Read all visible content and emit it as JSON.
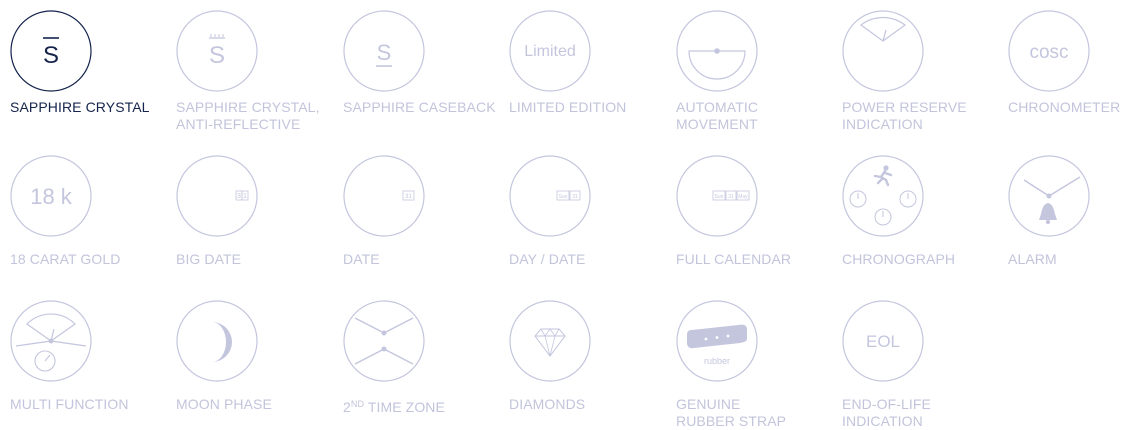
{
  "colors": {
    "active": "#15244b",
    "inactive": "#c2c4db",
    "icon_stroke": "#c4c6de"
  },
  "features": [
    {
      "id": "sapphire_crystal",
      "label1": "SAPPHIRE CRYSTAL",
      "label2": "",
      "icon": "letter-s-overline-icon",
      "glyph": "S",
      "active": true
    },
    {
      "id": "sapphire_crystal_ar",
      "label1": "SAPPHIRE CRYSTAL,",
      "label2": "ANTI-REFLECTIVE",
      "icon": "letter-s-antireflective-icon",
      "glyph": "S",
      "active": false
    },
    {
      "id": "sapphire_caseback",
      "label1": "SAPPHIRE CASEBACK",
      "label2": "",
      "icon": "letter-s-underline-icon",
      "glyph": "S",
      "active": false
    },
    {
      "id": "limited_edition",
      "label1": "LIMITED EDITION",
      "label2": "",
      "icon": "limited-text-icon",
      "glyph": "Limited",
      "active": false
    },
    {
      "id": "automatic_movement",
      "label1": "AUTOMATIC",
      "label2": "MOVEMENT",
      "icon": "rotor-icon",
      "active": false
    },
    {
      "id": "power_reserve",
      "label1": "POWER RESERVE",
      "label2": "INDICATION",
      "icon": "power-gauge-icon",
      "active": false
    },
    {
      "id": "chronometer",
      "label1": "CHRONOMETER",
      "label2": "",
      "icon": "cosc-text-icon",
      "glyph": "cosc",
      "active": false
    },
    {
      "id": "gold_18k",
      "label1": "18 CARAT GOLD",
      "label2": "",
      "icon": "karat-text-icon",
      "glyph": "18 k",
      "active": false
    },
    {
      "id": "big_date",
      "label1": "BIG DATE",
      "label2": "",
      "icon": "big-date-window-icon",
      "date": "3",
      "date2": "1",
      "active": false
    },
    {
      "id": "date",
      "label1": "DATE",
      "label2": "",
      "icon": "date-window-icon",
      "date": "31",
      "active": false
    },
    {
      "id": "day_date",
      "label1": "DAY / DATE",
      "label2": "",
      "icon": "day-date-window-icon",
      "day": "Sun",
      "date": "31",
      "active": false
    },
    {
      "id": "full_calendar",
      "label1": "FULL CALENDAR",
      "label2": "",
      "icon": "full-calendar-window-icon",
      "day": "Sun",
      "date": "31",
      "month": "May",
      "active": false
    },
    {
      "id": "chronograph",
      "label1": "CHRONOGRAPH",
      "label2": "",
      "icon": "chronograph-runner-icon",
      "active": false
    },
    {
      "id": "alarm",
      "label1": "ALARM",
      "label2": "",
      "icon": "alarm-bell-icon",
      "active": false
    },
    {
      "id": "multi_function",
      "label1": "MULTI FUNCTION",
      "label2": "",
      "icon": "multi-function-dial-icon",
      "active": false
    },
    {
      "id": "moon_phase",
      "label1": "MOON PHASE",
      "label2": "",
      "icon": "crescent-moon-icon",
      "active": false
    },
    {
      "id": "second_time_zone",
      "label1": "2",
      "label1_sup": "ND",
      "label1_rest": " TIME ZONE",
      "label2": "",
      "icon": "dual-hands-icon",
      "active": false
    },
    {
      "id": "diamonds",
      "label1": "DIAMONDS",
      "label2": "",
      "icon": "diamond-icon",
      "active": false
    },
    {
      "id": "rubber_strap",
      "label1": "GENUINE",
      "label2": "RUBBER STRAP",
      "icon": "rubber-strap-icon",
      "glyph": "rubber",
      "active": false
    },
    {
      "id": "end_of_life",
      "label1": "END-OF-LIFE",
      "label2": "INDICATION",
      "icon": "eol-text-icon",
      "glyph": "EOL",
      "active": false
    }
  ]
}
